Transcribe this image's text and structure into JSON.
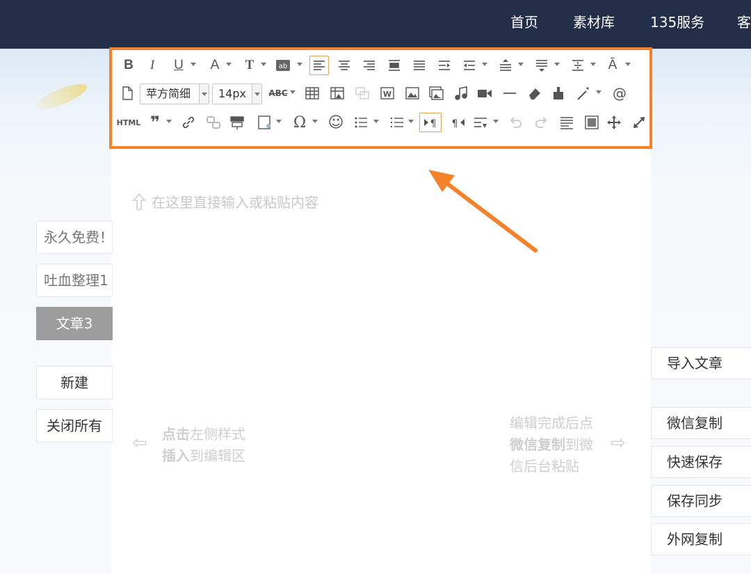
{
  "nav": {
    "items": [
      "首页",
      "素材库",
      "135服务",
      "客"
    ]
  },
  "toolbar": {
    "font_family": "苹方简细",
    "font_size": "14px",
    "html_label": "HTML",
    "abc_label": "ABC"
  },
  "editor": {
    "placeholder": "在这里直接输入或粘贴内容",
    "left_hint": {
      "line1_bold": "点击",
      "line1": "左侧样式",
      "line2_bold": "插入",
      "line2": "到编辑区"
    },
    "right_hint": {
      "line1": "编辑完成后点",
      "line2_bold": "微信复制",
      "line2": "到微",
      "line3": "信后台粘贴"
    }
  },
  "left_panel": {
    "input1": "永久免费！",
    "input2": "吐血整理1",
    "article_tab": "文章3",
    "new_button": "新建",
    "close_all_button": "关闭所有"
  },
  "right_panel": {
    "import": "导入文章",
    "wechat_copy": "微信复制",
    "quick_save": "快速保存",
    "save_sync": "保存同步",
    "external_copy": "外网复制"
  },
  "colors": {
    "topbar": "#232f48",
    "highlight": "#f5822a"
  }
}
